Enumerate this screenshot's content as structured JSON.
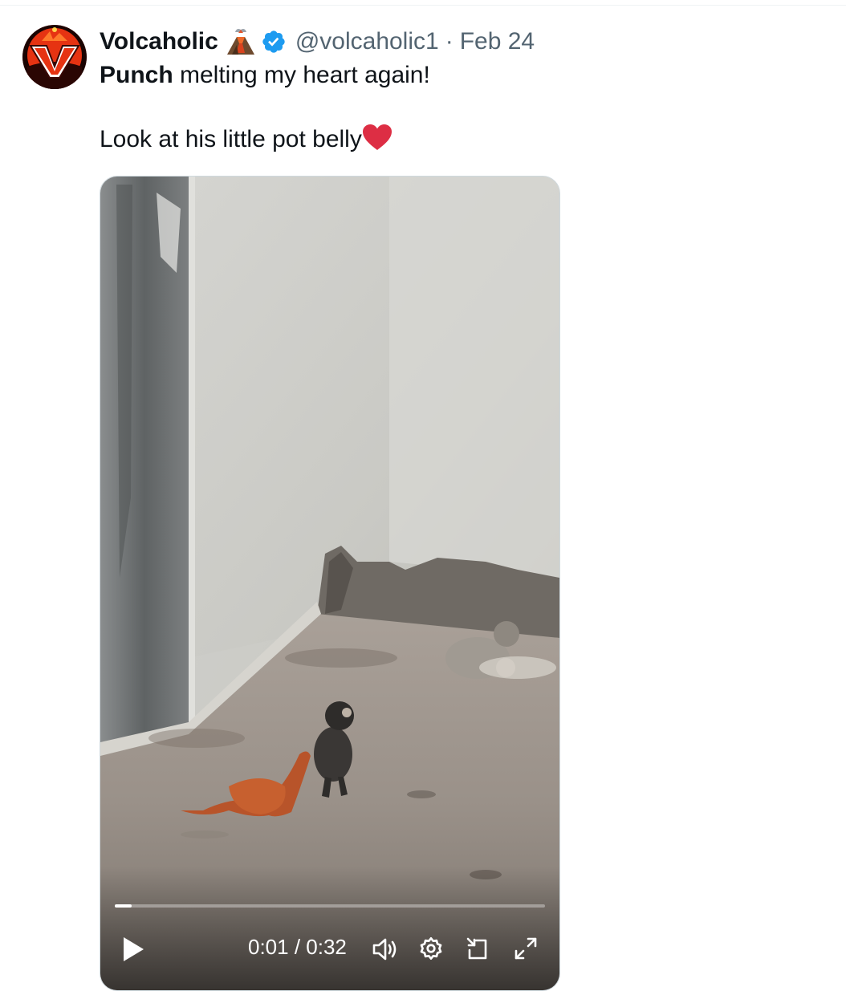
{
  "tweet": {
    "author": {
      "display_name": "Volcaholic",
      "name_emoji": "volcano-icon",
      "verified": true,
      "handle": "@volcaholic1",
      "separator": "·",
      "date": "Feb 24"
    },
    "text": {
      "bold_word": "Punch",
      "line1_rest": " melting my heart again!",
      "line2": "Look at his little pot belly",
      "trailing_emoji": "heart-icon"
    },
    "video": {
      "current_time": "0:01",
      "duration": "0:32",
      "time_separator": " / ",
      "progress_fraction": 0.04,
      "controls": [
        "play-icon",
        "volume-icon",
        "settings-icon",
        "dock-icon",
        "fullscreen-icon"
      ]
    }
  },
  "colors": {
    "text_primary": "#0f1419",
    "text_secondary": "#536471",
    "verified_blue": "#1d9bf0",
    "heart_red": "#dd2e44"
  }
}
